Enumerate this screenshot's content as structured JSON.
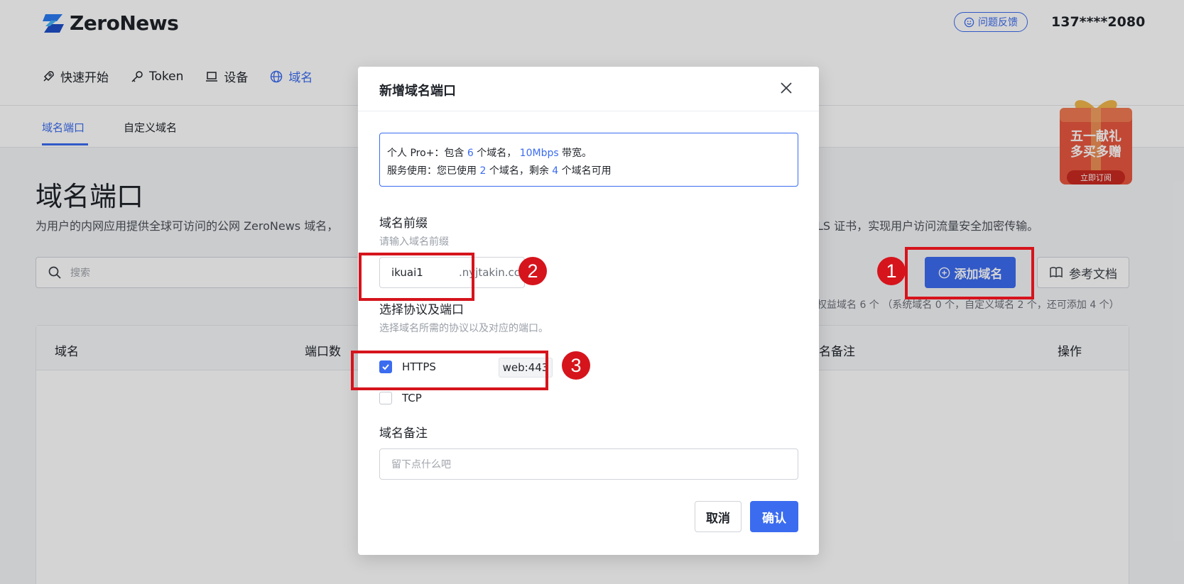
{
  "header": {
    "logo_text": "ZeroNews",
    "feedback_label": "问题反馈",
    "user_phone": "137****2080"
  },
  "main_nav": [
    {
      "label": "快速开始",
      "icon": "rocket-icon"
    },
    {
      "label": "Token",
      "icon": "key-icon"
    },
    {
      "label": "设备",
      "icon": "laptop-icon"
    },
    {
      "label": "域名",
      "icon": "globe-icon"
    }
  ],
  "sub_nav": [
    {
      "label": "域名端口",
      "active": true
    },
    {
      "label": "自定义域名",
      "active": false
    }
  ],
  "page": {
    "title": "域名端口",
    "description_left": "为用户的内网应用提供全球可访问的公网 ZeroNews 域名，",
    "description_right": "LS 证书，实现用户访问流量安全加密传输。",
    "search_placeholder": "搜索",
    "add_button": "添加域名",
    "docs_button": "参考文档",
    "quota_text": "权益域名 6 个 （系统域名 0 个，自定义域名 2 个，还可添加 4 个）"
  },
  "table": {
    "columns": [
      "域名",
      "端口数",
      "名备注",
      "操作"
    ]
  },
  "promo": {
    "line1": "五一献礼",
    "line2": "多买多赠",
    "cta": "立即订阅"
  },
  "modal": {
    "title": "新增域名端口",
    "plan_line": {
      "prefix": "个人 Pro+：包含 ",
      "domains": "6",
      "mid": " 个域名， ",
      "bandwidth": "10Mbps",
      "suffix": " 带宽。"
    },
    "usage_line": {
      "prefix": "服务使用：您已使用 ",
      "used": "2",
      "mid": " 个域名，剩余 ",
      "remaining": "4",
      "suffix": " 个域名可用"
    },
    "prefix_label": "域名前缀",
    "prefix_hint": "请输入域名前缀",
    "prefix_value": "ikuai1",
    "prefix_suffix": ".nyjtakin.cc",
    "protocol_label": "选择协议及端口",
    "protocol_hint": "选择域名所需的协议以及对应的端口。",
    "protocols": [
      {
        "label": "HTTPS",
        "checked": true,
        "port": "web:443"
      },
      {
        "label": "TCP",
        "checked": false
      }
    ],
    "note_label": "域名备注",
    "note_placeholder": "留下点什么吧",
    "cancel_label": "取消",
    "confirm_label": "确认"
  },
  "annotations": [
    "1",
    "2",
    "3"
  ],
  "colors": {
    "accent": "#3b6cf0",
    "annotation_red": "#d6141c"
  }
}
